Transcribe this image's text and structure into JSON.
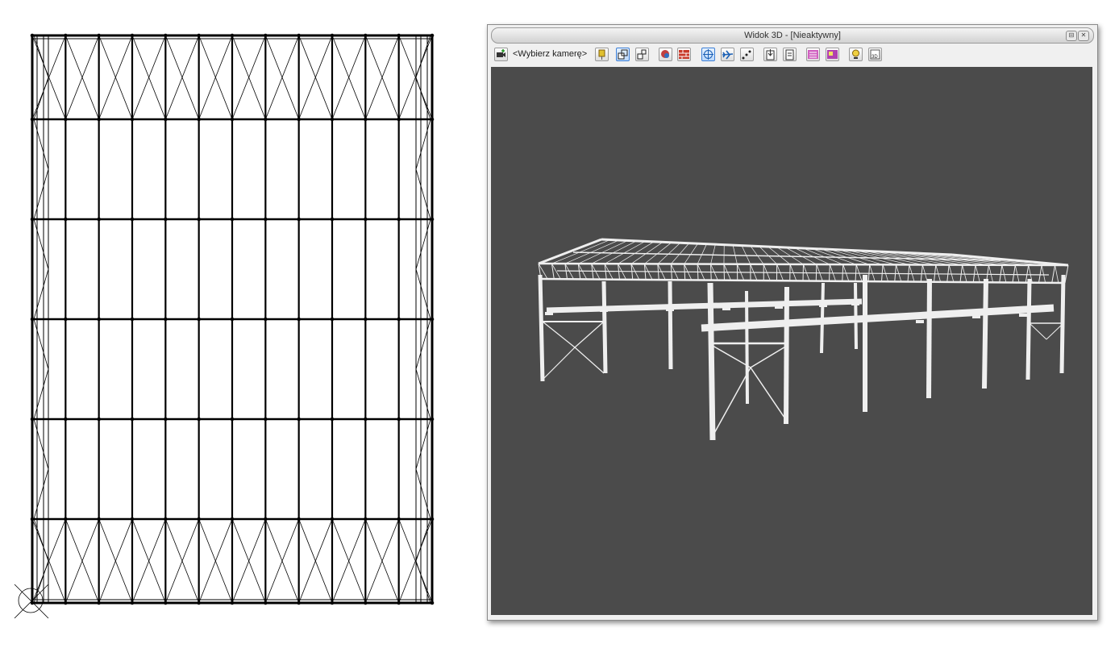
{
  "window": {
    "title": "Widok 3D - [Nieaktywny]",
    "minimize_glyph": "⊟",
    "close_glyph": "✕"
  },
  "toolbar": {
    "camera_select": "<Wybierz kamerę>",
    "icons": [
      "add-camera-icon",
      "pin-icon",
      "parallel-projection-icon",
      "perspective-projection-icon",
      "render-mode-icon",
      "wall-texture-icon",
      "orbit-icon",
      "fly-icon",
      "walk-path-icon",
      "export-view-icon",
      "print-view-icon",
      "layers-icon",
      "materials-icon",
      "lighting-icon",
      "3d-settings-icon"
    ]
  },
  "colors": {
    "viewport_bg": "#4b4b4b",
    "model": "#f2f2f2",
    "plan_line": "#000000"
  }
}
